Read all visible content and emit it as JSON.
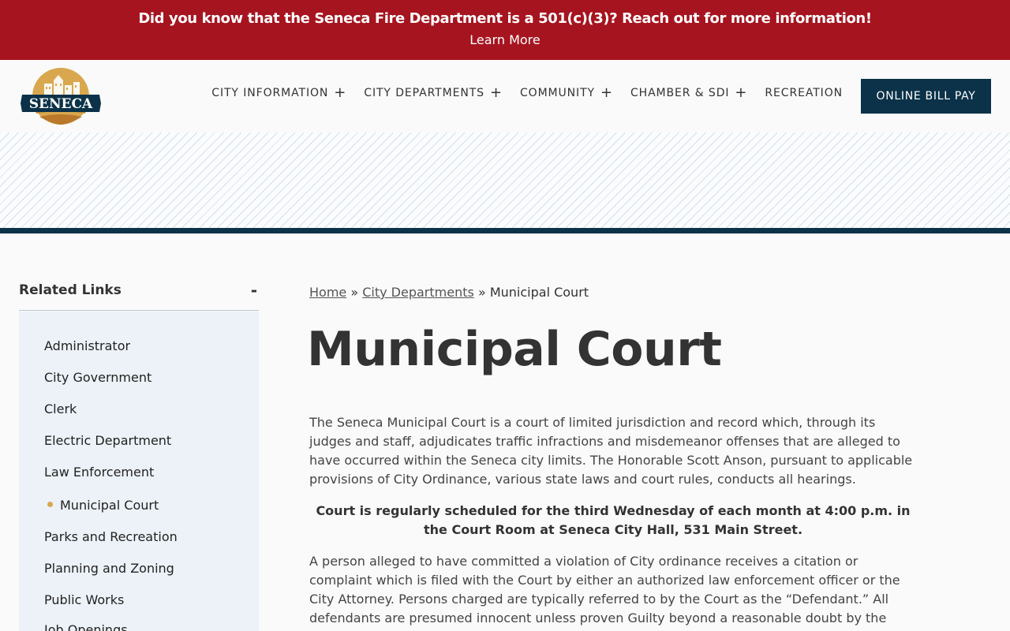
{
  "alert": {
    "message": "Did you know that the Seneca Fire Department is a 501(c)(3)? Reach out for more information!",
    "link_text": "Learn More"
  },
  "logo": {
    "text": "SENECA"
  },
  "nav": {
    "items": [
      {
        "label": "CITY INFORMATION",
        "has_submenu": true
      },
      {
        "label": "CITY DEPARTMENTS",
        "has_submenu": true
      },
      {
        "label": "COMMUNITY",
        "has_submenu": true
      },
      {
        "label": "CHAMBER & SDI",
        "has_submenu": true
      },
      {
        "label": "RECREATION",
        "has_submenu": false
      }
    ],
    "plus_icon": "+",
    "cta": "ONLINE BILL PAY"
  },
  "sidebar": {
    "title": "Related Links",
    "toggle": "-",
    "links": [
      {
        "label": "Administrator",
        "active": false
      },
      {
        "label": "City Government",
        "active": false
      },
      {
        "label": "Clerk",
        "active": false
      },
      {
        "label": "Electric Department",
        "active": false
      },
      {
        "label": "Law Enforcement",
        "active": false
      },
      {
        "label": "Municipal Court",
        "active": true
      },
      {
        "label": "Parks and Recreation",
        "active": false
      },
      {
        "label": "Planning and Zoning",
        "active": false
      },
      {
        "label": "Public Works",
        "active": false
      },
      {
        "label": "Job Openings",
        "active": false
      }
    ]
  },
  "breadcrumb": {
    "home": "Home",
    "separator": "»",
    "departments": "City Departments",
    "current": "Municipal Court"
  },
  "page": {
    "title": "Municipal Court",
    "paragraphs": [
      "The Seneca Municipal Court is a court of limited jurisdiction and record which,  through its judges and staff, adjudicates traffic infractions and misdemeanor offenses that are alleged to have occurred within the Seneca city limits.  The Honorable Scott Anson, pursuant to applicable provisions of City Ordinance, various state laws and court rules,  conducts all hearings.",
      "Court is regularly scheduled for the third Wednesday of each month at 4:00 p.m. in the Court Room at Seneca City Hall, 531 Main Street.",
      "A person alleged to have committed a violation of City ordinance receives a  citation or complaint which is filed with the Court by either an authorized law  enforcement officer or the City Attorney. Persons charged are typically  referred to by the Court as the “Defendant.” All defendants  are presumed innocent unless proven Guilty beyond a reasonable doubt by the"
    ]
  },
  "colors": {
    "alert_bg": "#a6141f",
    "navy": "#0b3248",
    "sidebar_bg": "#edf2f8",
    "accent_gold": "#d9a84e"
  }
}
